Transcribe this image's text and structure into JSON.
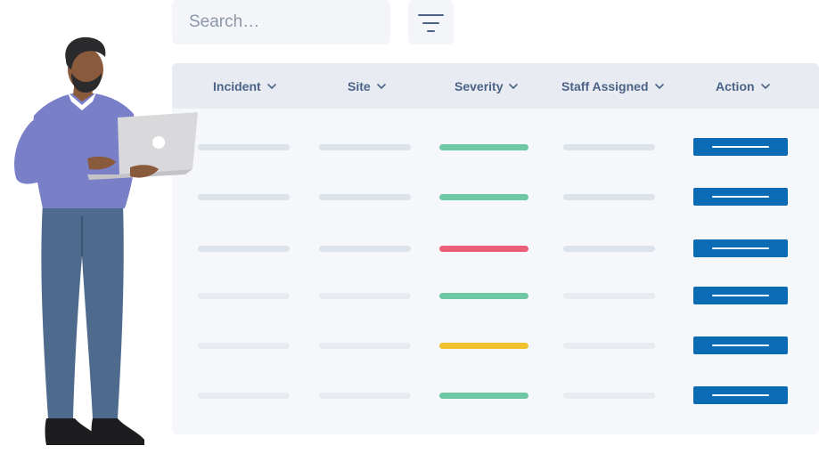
{
  "search": {
    "placeholder": "Search…"
  },
  "filter": {
    "icon": "filter-lines-icon"
  },
  "table": {
    "columns": [
      {
        "label": "Incident"
      },
      {
        "label": "Site"
      },
      {
        "label": "Severity"
      },
      {
        "label": "Staff Assigned"
      },
      {
        "label": "Action"
      }
    ],
    "rows": [
      {
        "severity_color": "#6fc8a5",
        "faded": false
      },
      {
        "severity_color": "#6fc8a5",
        "faded": false
      },
      {
        "severity_color": "#ec5f79",
        "faded": false
      },
      {
        "severity_color": "#6fc8a5",
        "faded": true
      },
      {
        "severity_color": "#f2c12e",
        "faded": true
      },
      {
        "severity_color": "#6fc8a5",
        "faded": true
      }
    ]
  },
  "colors": {
    "accent": "#0b6bb5",
    "header_text": "#4b6386",
    "placeholder_bar": "#dde3ea",
    "placeholder_bar_faded": "#e8ecf0"
  }
}
